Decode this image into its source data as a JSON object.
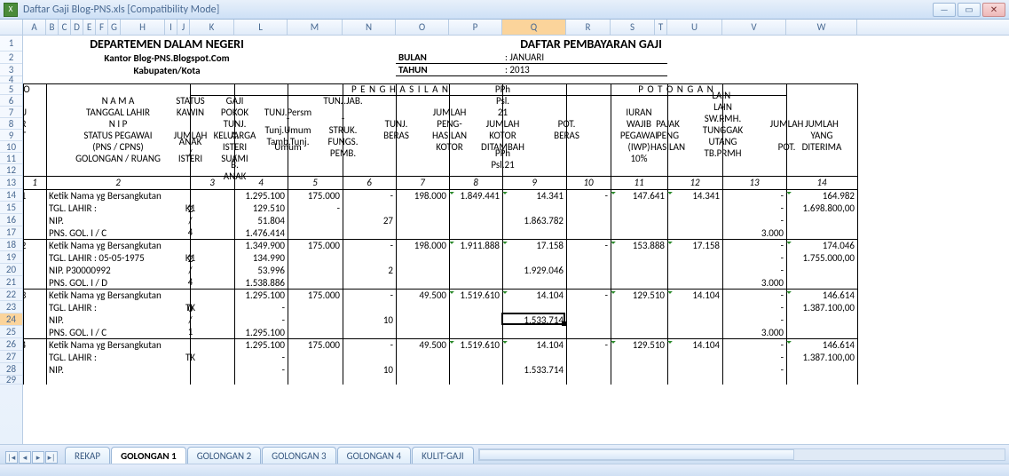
{
  "window": {
    "title": "Daftar Gaji Blog-PNS.xls  [Compatibility Mode]"
  },
  "columns": [
    "A",
    "B",
    "C",
    "D",
    "E",
    "F",
    "G",
    "H",
    "I",
    "J",
    "K",
    "L",
    "M",
    "N",
    "O",
    "P",
    "Q",
    "R",
    "S",
    "T",
    "U",
    "V",
    "W"
  ],
  "selected_col": "Q",
  "selected_row": "24",
  "row_numbers": [
    "1",
    "2",
    "3",
    "4",
    "5",
    "6",
    "7",
    "8",
    "9",
    "10",
    "11",
    "12",
    "13",
    "14",
    "15",
    "16",
    "17",
    "18",
    "19",
    "20",
    "21",
    "22",
    "23",
    "24",
    "25",
    "26",
    "27",
    "28",
    "29"
  ],
  "header": {
    "dept": "DEPARTEMEN DALAM NEGERI",
    "office": "Kantor Blog-PNS.Blogspot.Com",
    "region": "Kabupaten/Kota",
    "title": "DAFTAR PEMBAYARAN GAJI",
    "month_label": "BULAN",
    "month_value": ": JANUARI",
    "year_label": "TAHUN",
    "year_value": ": 2013"
  },
  "table_header": {
    "no": "NO",
    "urt": [
      "U",
      "R",
      "T"
    ],
    "nama": [
      "N A M A",
      "TANGGAL LAHIR",
      "N I P",
      "STATUS PEGAWAI",
      "(PNS / CPNS)",
      "GOLONGAN / RUANG"
    ],
    "status": [
      "STATUS",
      "KAWIN",
      "",
      "JUMLAH",
      "ANAK /",
      "ISTERI"
    ],
    "penghasilan": "P E N G H A S I L A N",
    "potongan": "P O T O N G A N",
    "col4": [
      "GAJI",
      "POKOK",
      "TUNJ.",
      "KELUARGA",
      "A. ISTERI /",
      "    SUAMI",
      "B. ANAK"
    ],
    "col5": [
      "",
      "TUNJ.Persm",
      "-Tunj.Umum",
      "-Tamb.Tunj.",
      "Umum"
    ],
    "col6": [
      "TUNJ.JAB.",
      "",
      "- STRUK.",
      "- FUNGS.",
      "- PEMB."
    ],
    "col7": [
      "",
      "",
      "TUNJ.",
      "BERAS"
    ],
    "col8": [
      "",
      "JUMLAH",
      "PENG-",
      "HASILAN",
      "KOTOR"
    ],
    "col9": [
      "PPh Psl. 21",
      "",
      "JUMLAH",
      "KOTOR",
      "DITAMBAH",
      "PPh Psl.21"
    ],
    "col10": [
      "",
      "",
      "POT.",
      "BERAS"
    ],
    "col11": [
      "",
      "IURAN",
      "WAJIB",
      "PEGAWAI",
      "(IWP)",
      "10%"
    ],
    "col12": [
      "",
      "",
      "PAJAK",
      "PENG",
      "HASILAN"
    ],
    "col13": [
      "LAIN-LAIN",
      "- SW.RMH.",
      "- TUNGGAK",
      "- UTANG",
      "- TB.PRMH"
    ],
    "col14": [
      "",
      "",
      "JUMLAH",
      "",
      "POT."
    ],
    "col15": [
      "",
      "JUMLAH",
      "YANG",
      "DITERIMA"
    ]
  },
  "colnums": [
    "1",
    "2",
    "3",
    "4",
    "5",
    "6",
    "7",
    "8",
    "9",
    "10",
    "11",
    "12",
    "13",
    "14",
    "15"
  ],
  "rows": [
    {
      "no": "1",
      "nama": [
        "Ketik Nama yg Bersangkutan",
        "TGL. LAHIR :",
        "NIP.",
        "PNS.     GOL.  I / C"
      ],
      "status": [
        "",
        "K1",
        "2  /  4",
        ""
      ],
      "c4": [
        "1.295.100",
        "129.510",
        "51.804",
        "1.476.414"
      ],
      "c5": [
        "175.000",
        "-",
        "",
        ""
      ],
      "c6": [
        "-",
        "",
        "27",
        ""
      ],
      "c7": [
        "198.000",
        "",
        "",
        ""
      ],
      "c8": [
        "1.849.441",
        "",
        "",
        ""
      ],
      "c9": [
        "14.341",
        "",
        "1.863.782",
        ""
      ],
      "c10": [
        "-",
        "",
        "",
        ""
      ],
      "c11": [
        "147.641",
        "",
        "",
        ""
      ],
      "c12": [
        "14.341",
        "",
        "",
        ""
      ],
      "c13": [
        "-",
        "-",
        "-",
        "3.000"
      ],
      "c14": [
        "164.982",
        "",
        "",
        ""
      ],
      "c15": [
        "",
        "1.698.800,00",
        "",
        ""
      ]
    },
    {
      "no": "2",
      "nama": [
        "Ketik Nama yg Bersangkutan",
        "TGL. LAHIR :   05-05-1975",
        "NIP.  P30000992",
        "PNS.     GOL.  I / D"
      ],
      "status": [
        "",
        "K1",
        "2  /  4",
        ""
      ],
      "c4": [
        "1.349.900",
        "134.990",
        "53.996",
        "1.538.886"
      ],
      "c5": [
        "175.000",
        "",
        "",
        ""
      ],
      "c6": [
        "-",
        "",
        "2",
        ""
      ],
      "c7": [
        "198.000",
        "",
        "",
        ""
      ],
      "c8": [
        "1.911.888",
        "",
        "",
        ""
      ],
      "c9": [
        "17.158",
        "",
        "1.929.046",
        ""
      ],
      "c10": [
        "-",
        "",
        "",
        ""
      ],
      "c11": [
        "153.888",
        "",
        "",
        ""
      ],
      "c12": [
        "17.158",
        "",
        "",
        ""
      ],
      "c13": [
        "-",
        "-",
        "-",
        "3.000"
      ],
      "c14": [
        "174.046",
        "",
        "",
        ""
      ],
      "c15": [
        "",
        "1.755.000,00",
        "",
        ""
      ]
    },
    {
      "no": "3",
      "nama": [
        "Ketik Nama yg Bersangkutan",
        "TGL. LAHIR :",
        "NIP.",
        "PNS.     GOL.  I / C"
      ],
      "status": [
        "",
        "TK",
        "0  /  1",
        ""
      ],
      "c4": [
        "1.295.100",
        "-",
        "-",
        "1.295.100"
      ],
      "c5": [
        "175.000",
        "",
        "",
        ""
      ],
      "c6": [
        "-",
        "",
        "10",
        ""
      ],
      "c7": [
        "49.500",
        "",
        "",
        ""
      ],
      "c8": [
        "1.519.610",
        "",
        "",
        ""
      ],
      "c9": [
        "14.104",
        "",
        "1.533.714",
        ""
      ],
      "c10": [
        "-",
        "",
        "",
        ""
      ],
      "c11": [
        "129.510",
        "",
        "",
        ""
      ],
      "c12": [
        "14.104",
        "",
        "",
        ""
      ],
      "c13": [
        "-",
        "-",
        "-",
        "3.000"
      ],
      "c14": [
        "146.614",
        "",
        "",
        ""
      ],
      "c15": [
        "",
        "1.387.100,00",
        "",
        ""
      ]
    },
    {
      "no": "4",
      "nama": [
        "Ketik Nama yg Bersangkutan",
        "TGL. LAHIR :",
        "NIP.",
        ""
      ],
      "status": [
        "",
        "TK",
        "",
        ""
      ],
      "c4": [
        "1.295.100",
        "-",
        "-",
        ""
      ],
      "c5": [
        "175.000",
        "",
        "",
        ""
      ],
      "c6": [
        "-",
        "",
        "10",
        ""
      ],
      "c7": [
        "49.500",
        "",
        "",
        ""
      ],
      "c8": [
        "1.519.610",
        "",
        "",
        ""
      ],
      "c9": [
        "14.104",
        "",
        "1.533.714",
        ""
      ],
      "c10": [
        "-",
        "",
        "",
        ""
      ],
      "c11": [
        "129.510",
        "",
        "",
        ""
      ],
      "c12": [
        "14.104",
        "",
        "",
        ""
      ],
      "c13": [
        "-",
        "-",
        "-",
        ""
      ],
      "c14": [
        "146.614",
        "",
        "",
        ""
      ],
      "c15": [
        "",
        "1.387.100,00",
        "",
        ""
      ]
    }
  ],
  "tabs": [
    "REKAP",
    "GOLONGAN 1",
    "GOLONGAN 2",
    "GOLONGAN 3",
    "GOLONGAN  4",
    "KULIT-GAJI"
  ],
  "active_tab": 1
}
